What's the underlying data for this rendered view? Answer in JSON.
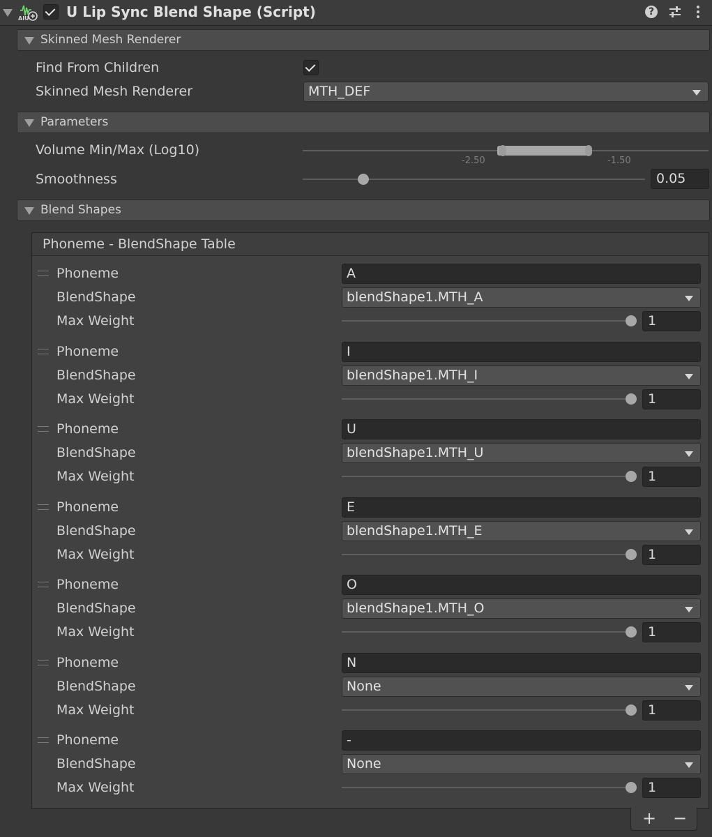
{
  "component": {
    "title": "U Lip Sync Blend Shape (Script)",
    "enabled": true,
    "icon_name": "audio-lipsync-icon",
    "icon_badge": "AIU",
    "header_icons": [
      "help-icon",
      "preset-sliders-icon",
      "kebab-menu-icon"
    ]
  },
  "sections": {
    "skinned_mesh_renderer": "Skinned Mesh Renderer",
    "parameters": "Parameters",
    "blend_shapes": "Blend Shapes"
  },
  "skinned": {
    "find_from_children_label": "Find From Children",
    "find_from_children": true,
    "renderer_label": "Skinned Mesh Renderer",
    "renderer_value": "MTH_DEF"
  },
  "parameters": {
    "volume_label": "Volume Min/Max (Log10)",
    "volume_min": -2.1,
    "volume_max": -1.5,
    "volume_tick_labels": [
      "-2.50",
      "-1.50"
    ],
    "smoothness_label": "Smoothness",
    "smoothness_value": "0.05",
    "smoothness_fraction": 0.18
  },
  "table": {
    "title": "Phoneme - BlendShape Table",
    "phoneme_label": "Phoneme",
    "blendshape_label": "BlendShape",
    "max_weight_label": "Max Weight",
    "rows": [
      {
        "phoneme": "A",
        "blendshape": "blendShape1.MTH_A",
        "max_weight": "1"
      },
      {
        "phoneme": "I",
        "blendshape": "blendShape1.MTH_I",
        "max_weight": "1"
      },
      {
        "phoneme": "U",
        "blendshape": "blendShape1.MTH_U",
        "max_weight": "1"
      },
      {
        "phoneme": "E",
        "blendshape": "blendShape1.MTH_E",
        "max_weight": "1"
      },
      {
        "phoneme": "O",
        "blendshape": "blendShape1.MTH_O",
        "max_weight": "1"
      },
      {
        "phoneme": "N",
        "blendshape": "None",
        "max_weight": "1"
      },
      {
        "phoneme": "-",
        "blendshape": "None",
        "max_weight": "1"
      }
    ],
    "add_label": "+",
    "remove_label": "−"
  }
}
